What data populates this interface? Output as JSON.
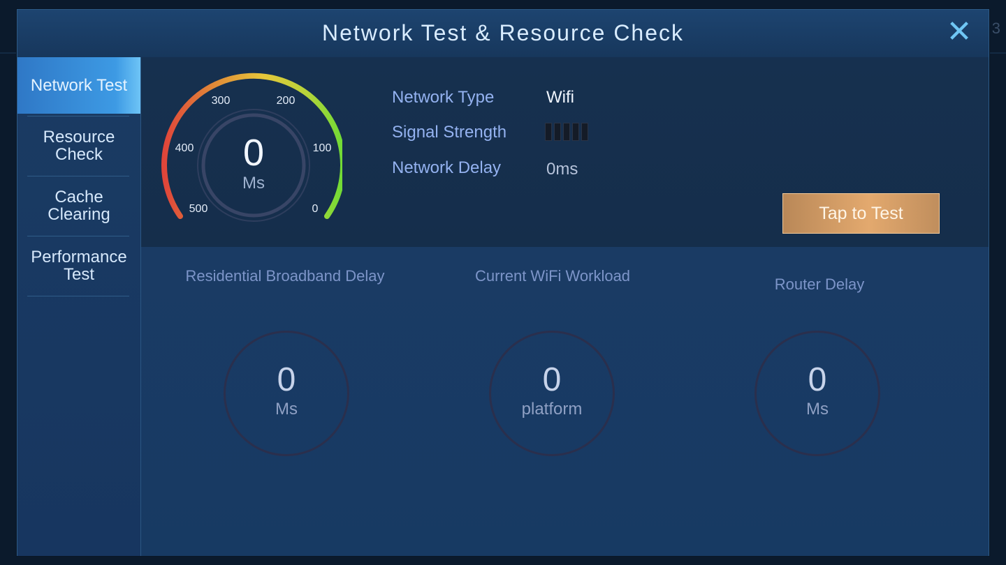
{
  "dialog": {
    "title": "Network Test & Resource Check",
    "close_icon": "close-x-icon"
  },
  "sidebar": {
    "items": [
      {
        "label": "Network Test",
        "active": true
      },
      {
        "label": "Resource Check",
        "active": false
      },
      {
        "label": "Cache Clearing",
        "active": false
      },
      {
        "label": "Performance Test",
        "active": false
      }
    ]
  },
  "gauge": {
    "value": "0",
    "unit": "Ms",
    "ticks": [
      "500",
      "400",
      "300",
      "200",
      "100",
      "0"
    ]
  },
  "network_info": {
    "type_label": "Network Type",
    "type_value": "Wifi",
    "signal_label": "Signal Strength",
    "signal_bars_total": 5,
    "signal_bars_filled": 0,
    "delay_label": "Network Delay",
    "delay_value": "0ms"
  },
  "test_button": {
    "label": "Tap to Test"
  },
  "metrics": [
    {
      "title": "Residential Broadband Delay",
      "value": "0",
      "unit": "Ms"
    },
    {
      "title": "Current WiFi Workload",
      "value": "0",
      "unit": "platform"
    },
    {
      "title": "Router Delay",
      "value": "0",
      "unit": "Ms"
    }
  ],
  "background": {
    "edge_text": "3"
  },
  "colors": {
    "panel": "#163459",
    "accent_blue": "#3d9ae4",
    "button_gold": "#e3a96e",
    "label_text": "#94b2f0"
  }
}
